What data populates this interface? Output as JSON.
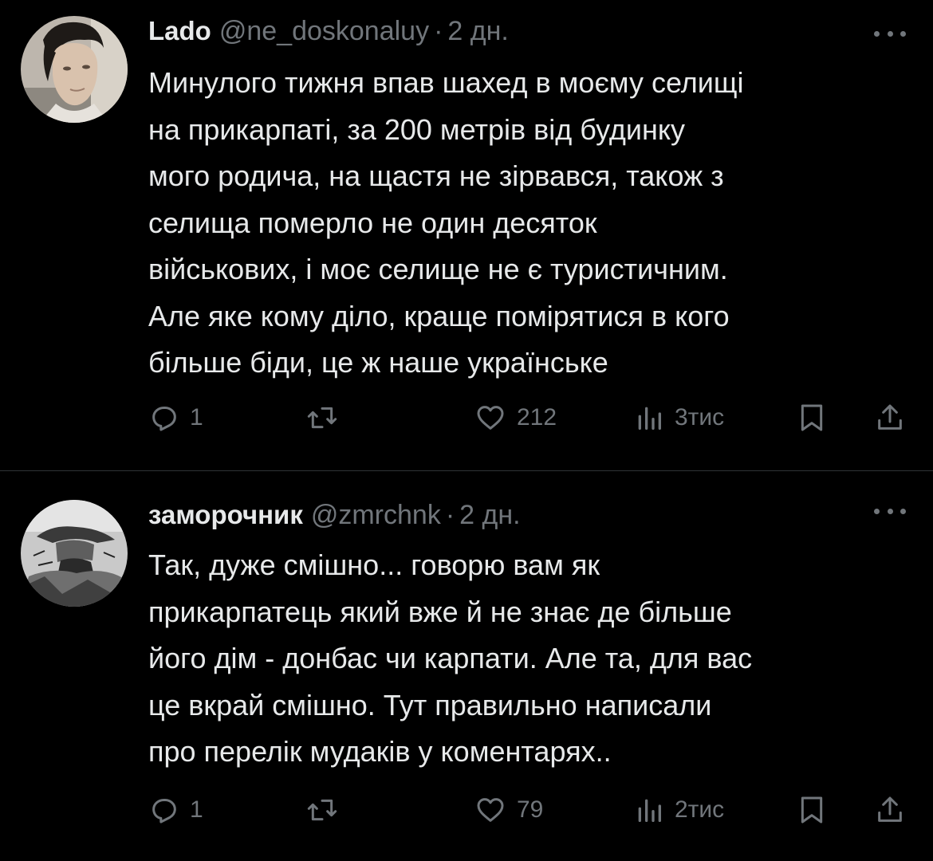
{
  "tweets": [
    {
      "display_name": "Lado",
      "handle": "@ne_doskonaluy",
      "separator": "·",
      "time": "2 дн.",
      "text_lines": [
        "Минулого тижня впав шахед в моєму селищі",
        "на прикарпаті, за 200 метрів від будинку",
        "мого родича, на щастя не зірвався, також з",
        "селища померло не один десяток",
        "військових, і моє селище не є туристичним.",
        "Але яке кому діло, краще помірятися в кого",
        "більше біди, це ж наше українське"
      ],
      "replies": "1",
      "likes": "212",
      "views": "3тис"
    },
    {
      "display_name": "заморочник",
      "handle": "@zmrchnk",
      "separator": "·",
      "time": "2 дн.",
      "text_lines": [
        "Так, дуже смішно... говорю вам як",
        "прикарпатець який вже й не знає де більше",
        "його дім - донбас чи карпати. Але та, для вас",
        "це вкрай смішно. Тут правильно написали",
        "про перелік мудаків у коментарях.."
      ],
      "replies": "1",
      "likes": "79",
      "views": "2тис"
    }
  ],
  "colors": {
    "background": "#000000",
    "text_primary": "#e7e9ea",
    "text_secondary": "#71767b",
    "divider": "#2f3336"
  },
  "icons": [
    "avatar",
    "more-icon",
    "reply-icon",
    "retweet-icon",
    "like-icon",
    "views-icon",
    "bookmark-icon",
    "share-icon"
  ]
}
